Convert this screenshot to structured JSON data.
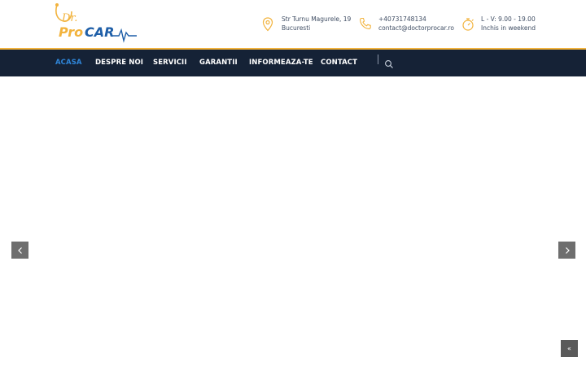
{
  "logo": {
    "prefix": "Dr.",
    "brand_pro": "Pro",
    "brand_car": "CAR"
  },
  "contact": {
    "address_line1": "Str Turnu Magurele, 19",
    "address_line2": "Bucuresti",
    "phone": "+40731748134",
    "email": "contact@doctorprocar.ro",
    "hours_line1": "L - V: 9.00 - 19.00",
    "hours_line2": "Inchis in weekend"
  },
  "nav": {
    "items": [
      {
        "label": "ACASA",
        "active": true
      },
      {
        "label": "DESPRE NOI"
      },
      {
        "label": "SERVICII"
      },
      {
        "label": "GARANTII"
      },
      {
        "label": "INFORMEAZA-TE"
      },
      {
        "label": "CONTACT"
      }
    ]
  },
  "slider": {
    "prev_glyph": "‹",
    "next_glyph": "›"
  },
  "back_to_top": {
    "glyph": "«"
  },
  "colors": {
    "nav_bg": "#152236",
    "accent": "#f2b33d",
    "active_link": "#2f86d9",
    "logo_blue": "#1f5fa8",
    "logo_yellow": "#f2b33d"
  },
  "icons": {
    "address": "map-pin-icon",
    "phone": "phone-icon",
    "hours": "stopwatch-icon",
    "search": "search-icon"
  }
}
